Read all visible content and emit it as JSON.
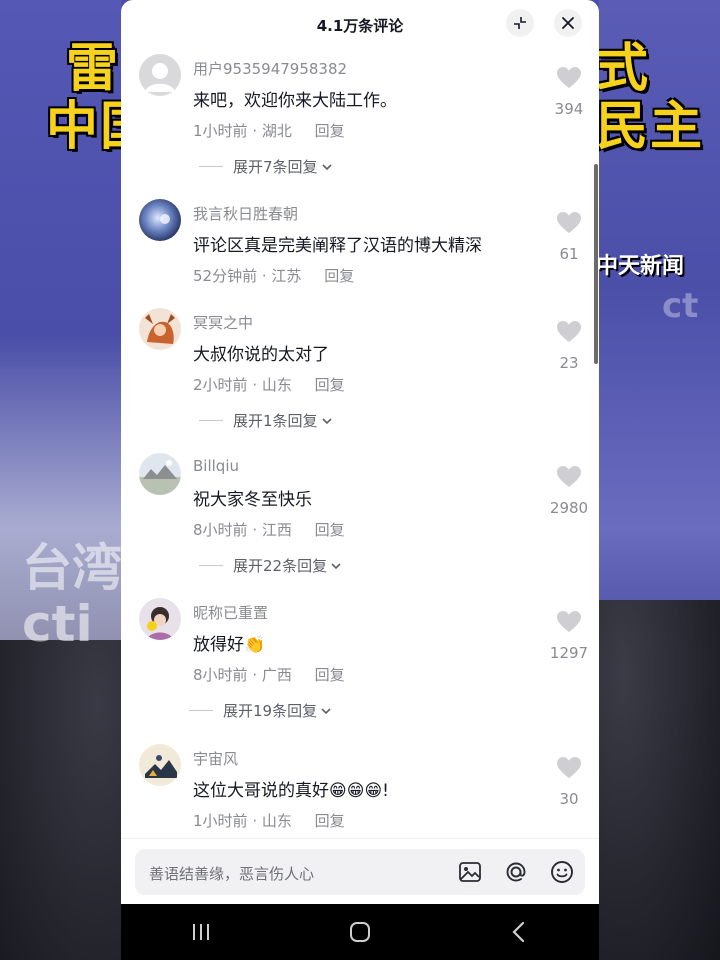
{
  "background_video": {
    "title_left_line1": "雷",
    "title_left_line2": "中国",
    "title_right_line1": "式",
    "title_right_line2": "民主",
    "channel_text": "中天新闻",
    "logo_text": "ct",
    "side_text": "台湾 cti"
  },
  "header": {
    "title": "4.1万条评论"
  },
  "comments": [
    {
      "username": "用户9535947958382",
      "text": "来吧，欢迎你来大陆工作。",
      "time": "1小时前",
      "location": "湖北",
      "reply_label": "回复",
      "likes": "394",
      "expand_label": "展开7条回复"
    },
    {
      "username": "我言秋日胜春朝",
      "text": "评论区真是完美阐释了汉语的博大精深",
      "time": "52分钟前",
      "location": "江苏",
      "reply_label": "回复",
      "likes": "61",
      "expand_label": ""
    },
    {
      "username": "冥冥之中",
      "text": "大叔你说的太对了",
      "time": "2小时前",
      "location": "山东",
      "reply_label": "回复",
      "likes": "23",
      "expand_label": "展开1条回复"
    },
    {
      "username": "Billqiu",
      "text": "祝大家冬至快乐",
      "time": "8小时前",
      "location": "江西",
      "reply_label": "回复",
      "likes": "2980",
      "expand_label": "展开22条回复"
    },
    {
      "username": "昵称已重置",
      "text": "放得好👏",
      "time": "8小时前",
      "location": "广西",
      "reply_label": "回复",
      "likes": "1297",
      "expand_label": "展开19条回复"
    },
    {
      "username": "宇宙风",
      "text": "这位大哥说的真好😁😁😁!",
      "time": "1小时前",
      "location": "山东",
      "reply_label": "回复",
      "likes": "30",
      "expand_label": ""
    }
  ],
  "input": {
    "placeholder": "善语结善缘，恶言伤人心"
  },
  "icons": {
    "collapse": "collapse-icon",
    "close": "close-icon",
    "like": "heart-icon",
    "image": "image-icon",
    "mention": "at-icon",
    "emoji": "emoji-icon",
    "nav_recents": "recents-icon",
    "nav_home": "home-icon",
    "nav_back": "back-icon"
  },
  "colors": {
    "sheet_bg": "#ffffff",
    "primary_text": "#161823",
    "secondary_text": "#8a8b91",
    "heart": "#cfcfd3",
    "navbar": "#000000"
  }
}
